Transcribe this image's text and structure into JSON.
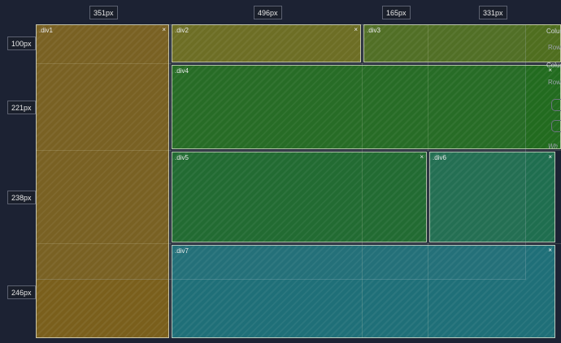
{
  "col_labels": [
    "351px",
    "496px",
    "165px",
    "331px"
  ],
  "row_labels": [
    "100px",
    "221px",
    "238px",
    "246px"
  ],
  "close_symbol": "×",
  "cells": [
    {
      "label": ".div1",
      "color": "#7a5f1c"
    },
    {
      "label": ".div2",
      "color": "#6d6d1e"
    },
    {
      "label": ".div3",
      "color": "#4f6e1f"
    },
    {
      "label": ".div4",
      "color": "#226b1f"
    },
    {
      "label": ".div5",
      "color": "#1d6a2c"
    },
    {
      "label": ".div6",
      "color": "#1f6e4f"
    },
    {
      "label": ".div7",
      "color": "#1f6f78"
    }
  ],
  "side_panel": {
    "items": [
      "Colum",
      "Rows",
      "Colum",
      "Row G",
      "Wh"
    ]
  }
}
